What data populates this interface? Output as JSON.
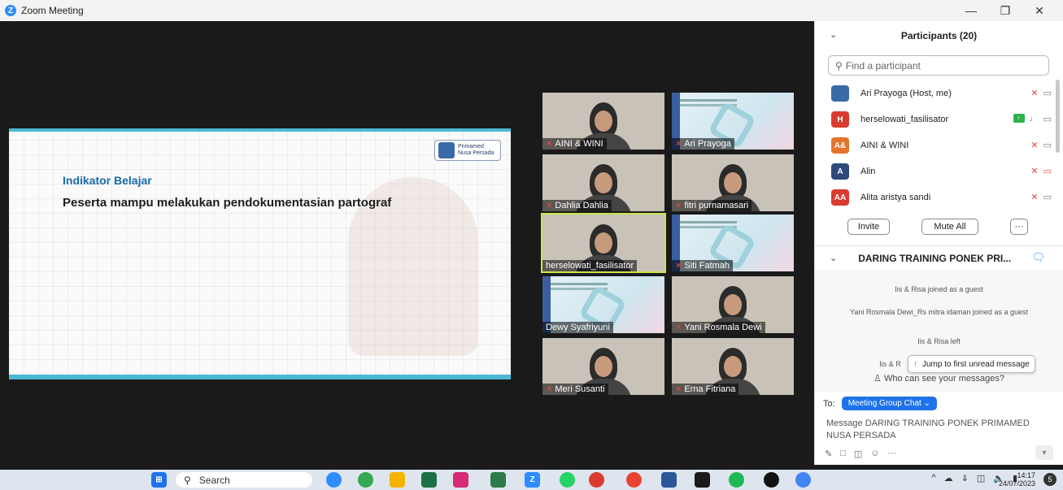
{
  "window": {
    "title": "Zoom Meeting",
    "controls": [
      "—",
      "❐",
      "✕"
    ]
  },
  "slide": {
    "logo_text": "Primamed",
    "logo_subtext": "Nusa Persada",
    "heading": "Indikator Belajar",
    "body": "Peserta mampu melakukan pendokumentasian partograf"
  },
  "gallery": [
    {
      "name": "AINI & WINI",
      "kind": "person",
      "muted": true
    },
    {
      "name": "Ari Prayoga",
      "kind": "slide",
      "muted": true
    },
    {
      "name": "Dahlia Dahlia",
      "kind": "person",
      "muted": true
    },
    {
      "name": "fitri purnamasari",
      "kind": "person",
      "muted": true
    },
    {
      "name": "herselowati_fasilisator",
      "kind": "person",
      "muted": false,
      "active": true
    },
    {
      "name": "Siti Fatmah",
      "kind": "slide",
      "muted": true
    },
    {
      "name": "Dewy Syafriyuni",
      "kind": "slide",
      "muted": false
    },
    {
      "name": "Yani Rosmala Dewi",
      "kind": "person",
      "muted": true
    },
    {
      "name": "Meri Susanti",
      "kind": "person",
      "muted": true
    },
    {
      "name": "Erna Fitriana",
      "kind": "person",
      "muted": true
    }
  ],
  "participants": {
    "title": "Participants (20)",
    "search_placeholder": "Find a participant",
    "list": [
      {
        "name": "Ari Prayoga (Host, me)",
        "avatar": "",
        "color": "#3a6aa8",
        "muted": true,
        "cam_off": false,
        "sharing": false
      },
      {
        "name": "herselowati_fasilisator",
        "avatar": "H",
        "color": "#d93b2e",
        "muted": false,
        "cam_off": false,
        "sharing": true
      },
      {
        "name": "AINI & WINI",
        "avatar": "A&",
        "color": "#e5742c",
        "muted": true,
        "cam_off": false,
        "sharing": false
      },
      {
        "name": "Alin",
        "avatar": "A",
        "color": "#2d4a7a",
        "muted": true,
        "cam_off": true,
        "sharing": false
      },
      {
        "name": "Alita aristya sandi",
        "avatar": "AA",
        "color": "#d93b2e",
        "muted": true,
        "cam_off": false,
        "sharing": false
      }
    ],
    "invite_label": "Invite",
    "mute_all_label": "Mute All",
    "more_label": "···"
  },
  "chat": {
    "title": "DARING TRAINING PONEK PRI...",
    "messages": [
      "Iis & Risa joined as a guest",
      "Yani Rosmala Dewi_Rs mitra idaman joined as a guest",
      "Iis & Risa left",
      "Iis & R"
    ],
    "jump_label": "Jump to first unread message",
    "who_label": "Who can see your messages?",
    "to_label": "To:",
    "recipient": "Meeting Group Chat ⌄",
    "placeholder": "Message DARING TRAINING PONEK PRIMAMED NUSA PERSADA"
  },
  "taskbar": {
    "search_label": "Search",
    "time": "14:17",
    "date": "24/07/2023",
    "notification_count": "5"
  },
  "colors": {
    "accent": "#2d8cff",
    "mute_red": "#e8473e",
    "active_outline": "#c8e84a"
  }
}
